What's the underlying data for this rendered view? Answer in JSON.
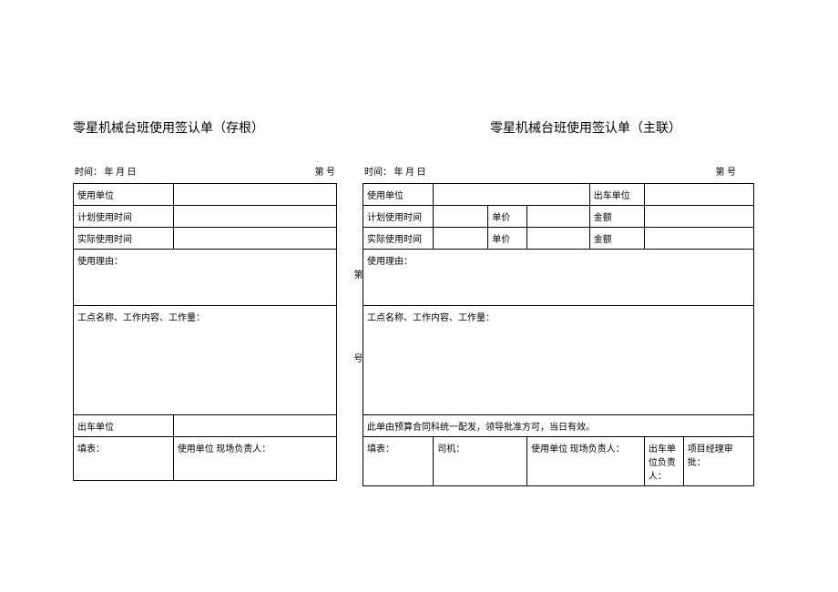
{
  "left": {
    "title": "零星机械台班使用签认单（存根）",
    "time_label": "时间：  年 月 日",
    "no_label": "第 号",
    "rows": {
      "using_unit": "使用单位",
      "plan_time": "计划使用时间",
      "actual_time": "实际使用时间",
      "reason": "使用理由：",
      "work": "工点名称、工作内容、工作量：",
      "dispatch_unit": "出车单位"
    },
    "sig": {
      "filler": "填表：",
      "unit_leader": "使用单位 现场负责人："
    }
  },
  "right": {
    "title": "零星机械台班使用签认单（主联）",
    "time_label": "时间：         年 月 日",
    "no_label": "第  号",
    "rows": {
      "using_unit": "使用单位",
      "dispatch_unit": "出车单位",
      "plan_time": "计划使用时间",
      "actual_time": "实际使用时间",
      "unit_price": "单价",
      "amount": "金额",
      "reason": "使用理由：",
      "work": "工点名称、工作内容、工作量：",
      "note": "此单由预算合同科统一配发，领导批准方可，当日有效。"
    },
    "sig": {
      "filler": "填表：",
      "driver": "司机：",
      "unit_leader": "使用单位 现场负责人：",
      "dispatch_leader": "出车单位负责人：",
      "pm": "项目经理审批："
    }
  },
  "marks": {
    "di": "第",
    "hao": "号"
  }
}
